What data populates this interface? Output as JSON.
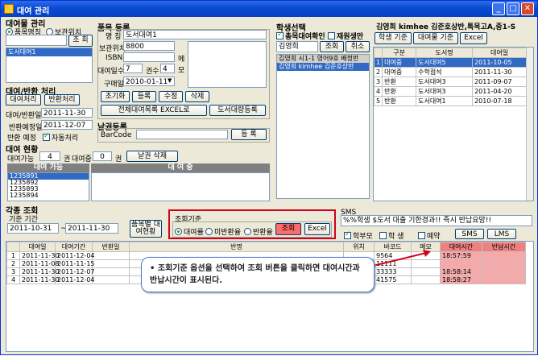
{
  "window": {
    "title": "대여 관리"
  },
  "book_mgmt": {
    "title": "대여물 관리",
    "radio_name": "품목명칭",
    "radio_location": "보관위치",
    "search_btn": "조 회",
    "list": [
      "도서대여1"
    ]
  },
  "item_reg": {
    "title": "품목 등록",
    "name_label": "명 칭",
    "name_value": "도서대여1",
    "location_label": "보관위치",
    "location_value": "8800",
    "isbn_label": "ISBN",
    "isbn_value": "",
    "days_label": "대여일수",
    "days_value": "7",
    "qty_label": "권수",
    "qty_value": "4",
    "purchase_label": "구매일",
    "purchase_value": "2010-01-11",
    "memo_label": "메 모",
    "btn_init": "초기화",
    "btn_register": "등록",
    "btn_modify": "수정",
    "btn_delete": "삭제",
    "btn_excel": "전체대여목록 EXCEL로",
    "btn_bulk": "도서대량등록"
  },
  "rent_return": {
    "title": "대여/반환 처리",
    "btn_rent": "대여처리",
    "btn_return": "반환처리",
    "date_label": "대여/반환일",
    "date_value": "2011-11-30",
    "due_label": "반환예정일",
    "due_value": "2011-12-07",
    "plan_label": "반환 예정",
    "auto_label": "자동처리"
  },
  "barcode": {
    "title": "낱권등록",
    "label": "BarCode",
    "value": "",
    "btn": "등 록"
  },
  "status": {
    "title": "대여 현황",
    "available_label": "대여가능",
    "available_value": "4",
    "unit1": "권",
    "renting_label": "대여중",
    "renting_value": "0",
    "unit2": "권",
    "btn_delete": "낱권 삭제",
    "col_available": "대여 가능",
    "col_renting": "대 여 중",
    "codes": [
      "1235891",
      "1235892",
      "1235893",
      "1235894"
    ]
  },
  "student": {
    "title": "학생선택",
    "chk_rent": "총목대여확인",
    "chk_enrolled": "재원생만",
    "search_value": "김영희",
    "btn_search": "조회",
    "btn_cancel": "취소",
    "list": [
      "김영희 시1-1 영어9호 배정반",
      "김영희 kimhee 김준호상반"
    ]
  },
  "history": {
    "title": "김영희 kimhee 김준호상반,특목고A,중1-S",
    "btn_student": "학생 기준",
    "btn_item": "대여물 기준",
    "btn_excel": "Excel",
    "headers": [
      "",
      "구분",
      "도서명",
      "대여일"
    ],
    "rows": [
      [
        "1",
        "대여중",
        "도서대여5",
        "2011-10-05"
      ],
      [
        "2",
        "대여중",
        "수학점석",
        "2011-11-30"
      ],
      [
        "3",
        "반환",
        "도서대여3",
        "2011-09-07"
      ],
      [
        "4",
        "반환",
        "도서대여3",
        "2011-04-20"
      ],
      [
        "5",
        "반환",
        "도서대여1",
        "2010-07-18"
      ]
    ]
  },
  "inquiry": {
    "title": "각종 조회",
    "period_label": "기준 기간",
    "from": "2011-10-31",
    "tilde": "~",
    "to": "2011-11-30",
    "btn_by_item": "품목별 대여현황",
    "criteria_title": "조회기준",
    "opt_rent": "대여률",
    "opt_unreturned": "미반환율",
    "opt_return": "반환율",
    "btn_search": "조회",
    "btn_excel": "Excel"
  },
  "sms": {
    "title": "SMS",
    "message": "%%학생 $도서 대출 기한경과!! 즉시 반납요망!!",
    "chk_parent": "학부모",
    "chk_student": "학 생",
    "chk_reserve": "예약",
    "btn_sms": "SMS",
    "btn_lms": "LMS"
  },
  "result": {
    "headers": [
      "",
      "대여일",
      "대여기간",
      "반환일",
      "반명",
      "위치",
      "바코드",
      "메모",
      "대여시간",
      "반납시간"
    ],
    "rows": [
      [
        "1",
        "2011-11-30",
        "2011-12-04",
        "",
        "",
        "",
        "9564",
        "",
        "18:57:59",
        ""
      ],
      [
        "2",
        "2011-11-08",
        "2011-11-15",
        "",
        "",
        "",
        "11111",
        "",
        "",
        ""
      ],
      [
        "3",
        "2011-11-30",
        "2011-12-07",
        "",
        "",
        "",
        "33333",
        "",
        "18:58:14",
        ""
      ],
      [
        "4",
        "2011-11-30",
        "2011-12-04",
        "",
        "",
        "",
        "41575",
        "",
        "18:58:27",
        ""
      ]
    ]
  },
  "callout": {
    "text": "• 조회기준 옵션을 선택하여 조회 버튼을 클릭하면 대여시간과 반납시간이 표시된다."
  }
}
